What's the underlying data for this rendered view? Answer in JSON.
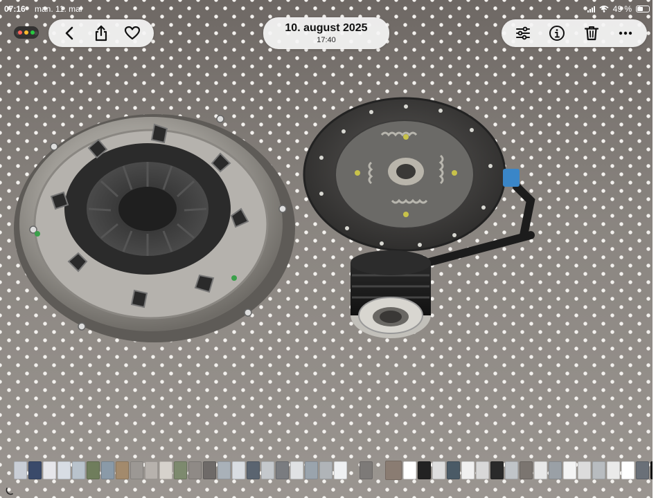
{
  "status_bar": {
    "time": "07:16",
    "date": "man. 11. mai",
    "battery": "49 %",
    "battery_level": 0.49
  },
  "header": {
    "title_date": "10. august 2025",
    "title_time": "17:40"
  },
  "toolbar_left": {
    "icons": [
      "back-icon",
      "share-icon",
      "heart-icon"
    ]
  },
  "toolbar_right": {
    "icons": [
      "adjust-icon",
      "info-icon",
      "trash-icon",
      "more-icon"
    ]
  },
  "window_controls": {
    "colors": [
      "#ff5f57",
      "#febc2e",
      "#28c840"
    ]
  },
  "thumbnails": {
    "colors": [
      "#c9ced6",
      "#3a4a6a",
      "#e6e6ea",
      "#d8dde4",
      "#b9c3cc",
      "#6f7d5c",
      "#8a9aa8",
      "#a38a6c",
      "#9c9894",
      "#b7b2ad",
      "#d6d2cc",
      "#7d8a6e",
      "#8f8a86",
      "#6e6a68",
      "#a9b1b9",
      "#d9dde2",
      "#5a6470",
      "#c4c8cc",
      "#7a7c80",
      "#e0e2e4",
      "#9aa4ad",
      "#b0b4b8",
      "#eef0f2",
      "gap",
      "#7d7a78",
      "gap",
      "#8a7c72",
      "#ffffff",
      "#222222",
      "#dedede",
      "#4a5a66",
      "#f0f0f0",
      "#d8d8d8",
      "#2a2a2a",
      "#c0c4c8",
      "#7b7570",
      "#e8e8e8",
      "#9aa0a6",
      "#f4f4f4",
      "#dcdcdc",
      "#b8bcc0",
      "#eaeaea",
      "#ffffff",
      "#6a7078",
      "#111111",
      "#b0b0b0",
      "#ffffff",
      "#3a3028",
      "#1a1a1a",
      "#2e2a26",
      "#d4d0cc",
      "#eeeeee"
    ],
    "current_index": 24
  }
}
